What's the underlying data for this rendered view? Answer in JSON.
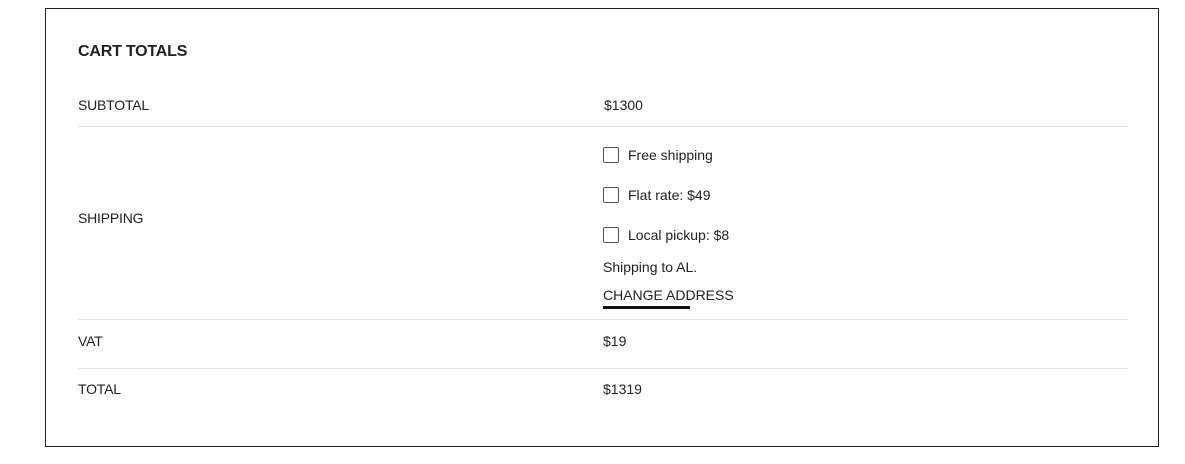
{
  "cart_totals": {
    "title": "CART TOTALS",
    "subtotal": {
      "label": "SUBTOTAL",
      "value": "$1300"
    },
    "shipping": {
      "label": "SHIPPING",
      "options": [
        {
          "label": "Free shipping",
          "checked": false
        },
        {
          "label": "Flat rate: $49",
          "checked": false
        },
        {
          "label": "Local pickup: $8",
          "checked": false
        }
      ],
      "destination_text": "Shipping to AL.",
      "change_address_label": "CHANGE ADDRESS"
    },
    "vat": {
      "label": "VAT",
      "value": "$19"
    },
    "total": {
      "label": "TOTAL",
      "value": "$1319"
    }
  },
  "colors": {
    "text": "#222222",
    "border": "#222222",
    "divider": "#e6e6e6",
    "link_underline": "#111111"
  }
}
